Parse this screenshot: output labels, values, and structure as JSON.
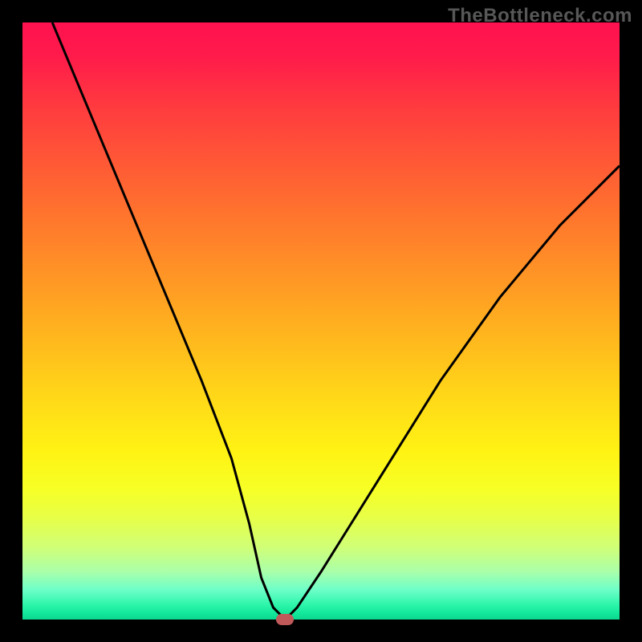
{
  "watermark": "TheBottleneck.com",
  "colors": {
    "background": "#000000",
    "watermark_text": "#575757",
    "curve_stroke": "#000000",
    "marker_fill": "#c05a5a"
  },
  "chart_data": {
    "type": "line",
    "title": "",
    "xlabel": "",
    "ylabel": "",
    "xlim": [
      0,
      100
    ],
    "ylim": [
      0,
      100
    ],
    "grid": false,
    "legend": false,
    "gradient_stops": [
      {
        "pos": 0.0,
        "hex": "#ff1150"
      },
      {
        "pos": 0.5,
        "hex": "#ffbb1d"
      },
      {
        "pos": 0.75,
        "hex": "#fff314"
      },
      {
        "pos": 1.0,
        "hex": "#0cd68e"
      }
    ],
    "series": [
      {
        "name": "bottleneck-curve",
        "x": [
          5,
          10,
          15,
          20,
          25,
          30,
          35,
          38,
          40,
          42,
          44,
          46,
          50,
          55,
          60,
          65,
          70,
          75,
          80,
          85,
          90,
          95,
          100
        ],
        "values": [
          100,
          88,
          76,
          64,
          52,
          40,
          27,
          16,
          7,
          2,
          0,
          2,
          8,
          16,
          24,
          32,
          40,
          47,
          54,
          60,
          66,
          71,
          76
        ]
      }
    ],
    "minimum_marker": {
      "x": 44,
      "y": 0
    }
  }
}
